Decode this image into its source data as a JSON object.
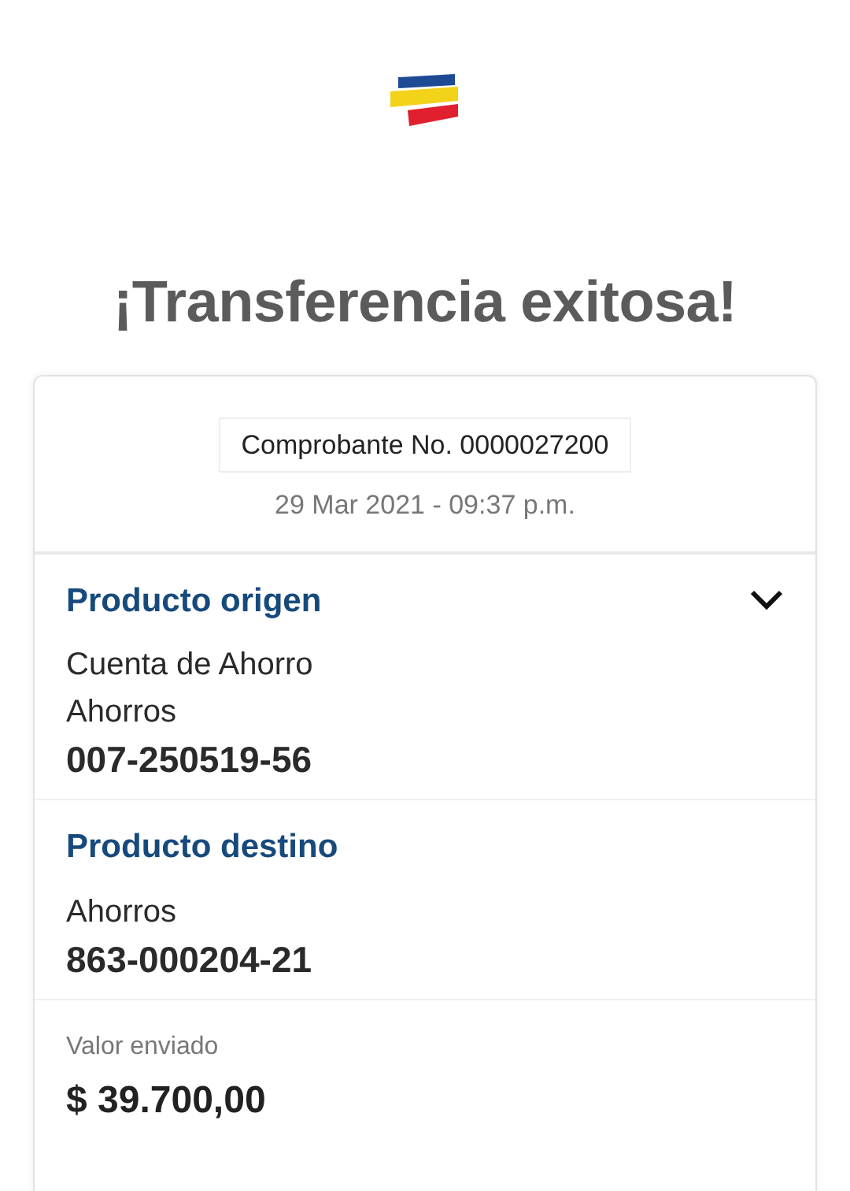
{
  "title": "¡Transferencia exitosa!",
  "receipt": {
    "number": "Comprobante No. 0000027200",
    "datetime": "29 Mar 2021 - 09:37 p.m."
  },
  "sections": [
    {
      "heading": "Producto origen",
      "expandable": true,
      "lines": [
        "Cuenta de Ahorro",
        "Ahorros"
      ],
      "account": "007-250519-56"
    },
    {
      "heading": "Producto destino",
      "expandable": false,
      "lines": [
        "Ahorros"
      ],
      "account": "863-000204-21"
    }
  ],
  "amount": {
    "label": "Valor enviado",
    "value": "$ 39.700,00"
  }
}
